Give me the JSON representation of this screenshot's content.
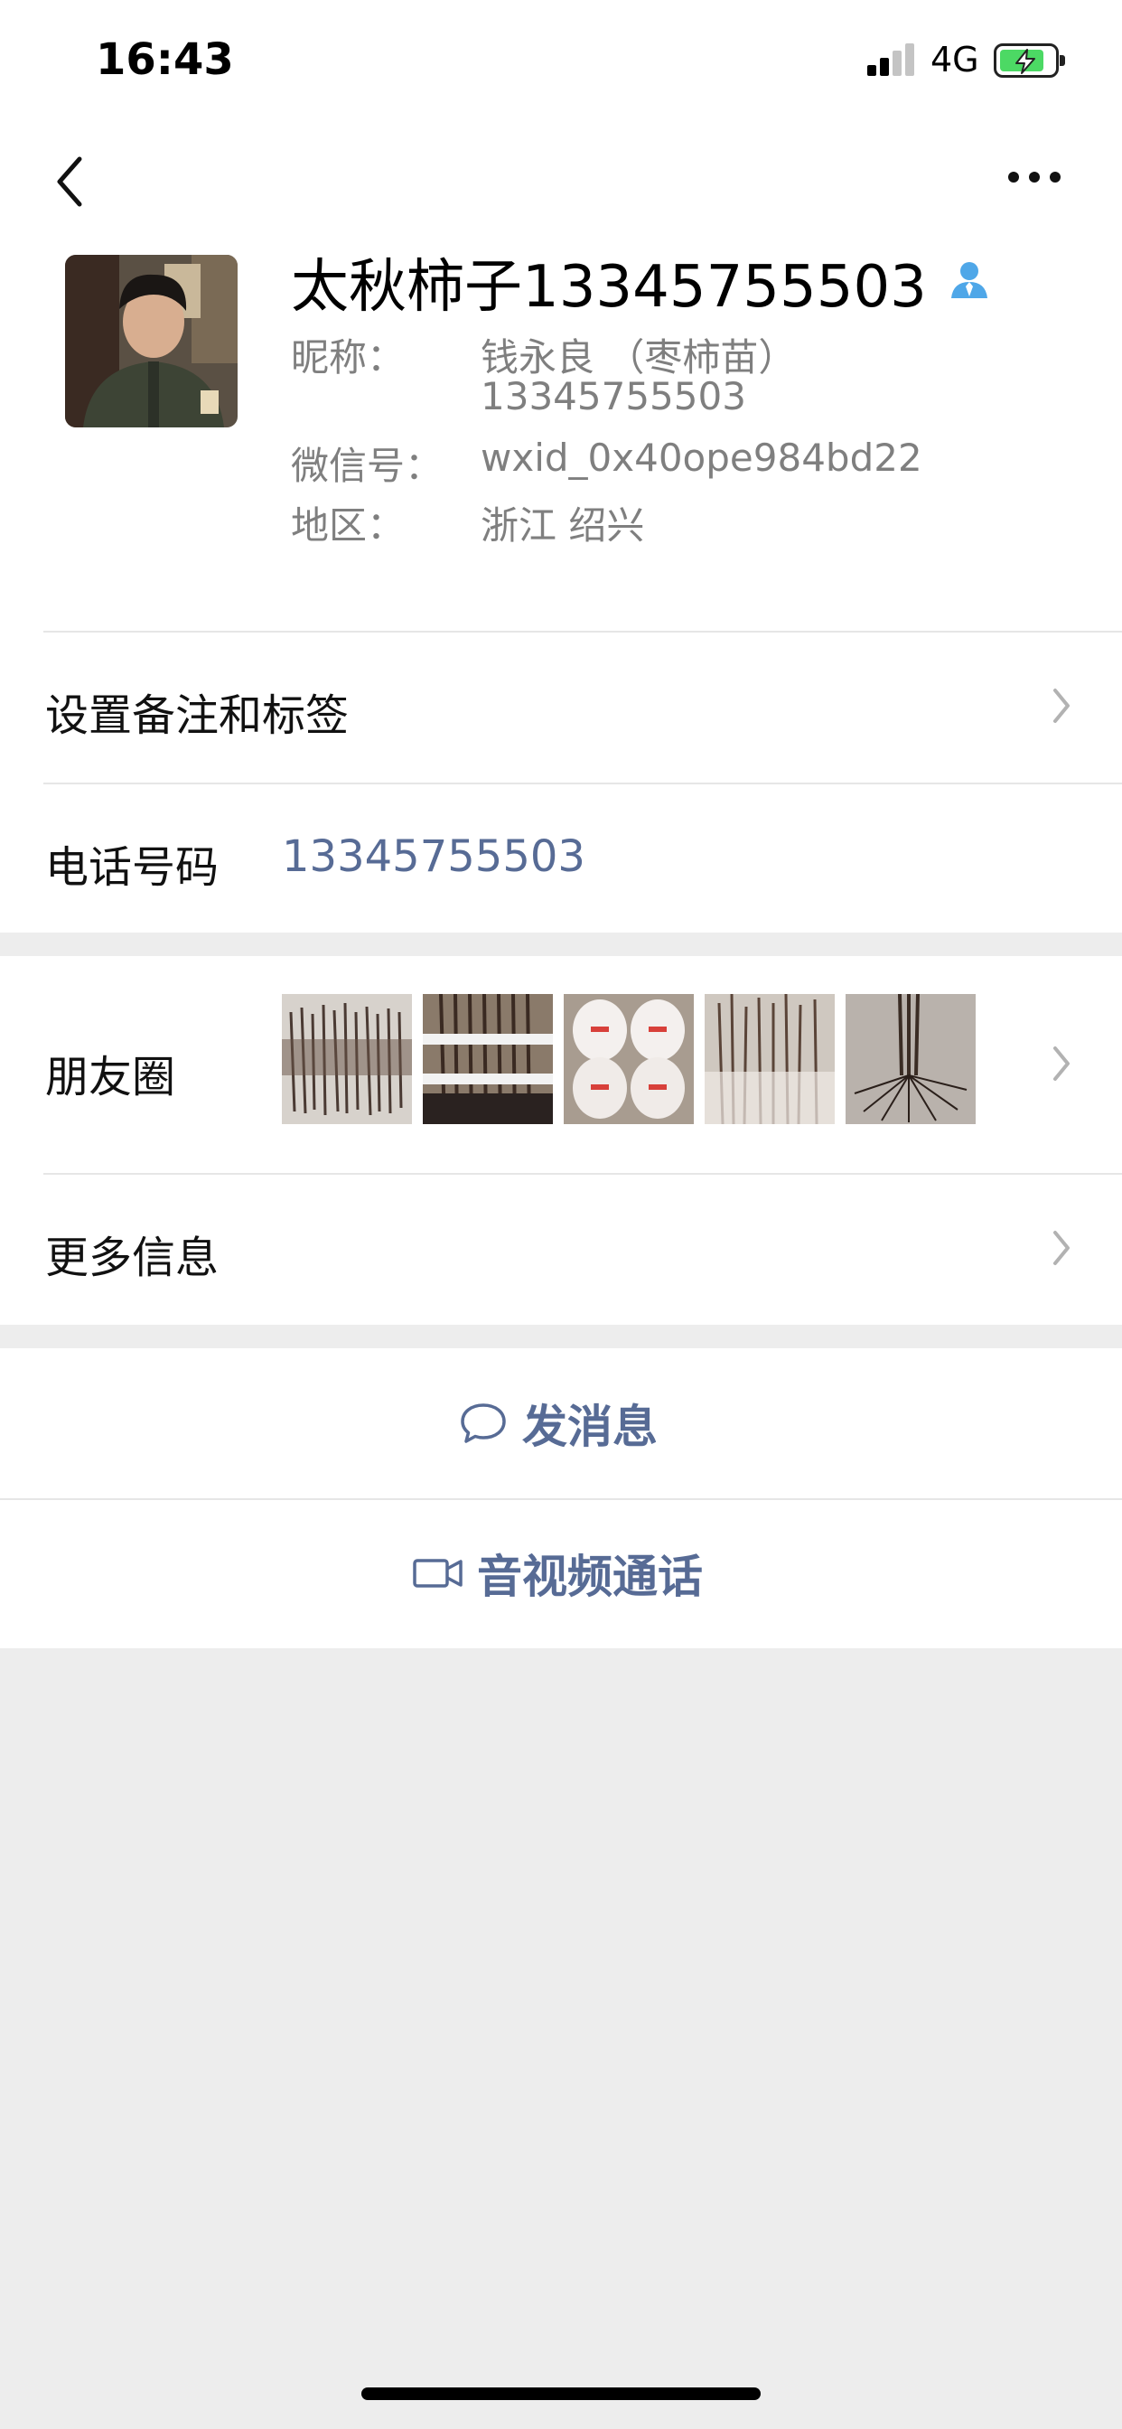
{
  "status_bar": {
    "time": "16:43",
    "network": "4G",
    "signal_level": 0.5,
    "battery_level": 0.85,
    "battery_charging": true
  },
  "nav": {
    "back_icon": "chevron-left-icon",
    "more_icon": "more-dots-icon"
  },
  "profile": {
    "display_name": "太秋柿子13345755503",
    "verify_icon": "contact-verified-icon",
    "nickname_label": "昵称：",
    "nickname_line1": "钱永良 （枣柿苗）",
    "nickname_line2": "13345755503",
    "wechat_id_label": "微信号：",
    "wechat_id": "wxid_0x40ope984bd22",
    "region_label": "地区：",
    "region": "浙江 绍兴"
  },
  "rows": {
    "remark_label": "设置备注和标签",
    "phone_label": "电话号码",
    "phone_value": "13345755503",
    "moments_label": "朋友圈",
    "more_info_label": "更多信息"
  },
  "actions": {
    "message_label": "发消息",
    "message_icon": "chat-bubble-icon",
    "call_label": "音视频通话",
    "call_icon": "video-camera-icon"
  },
  "colors": {
    "link_blue": "#576b95",
    "background_gray": "#ededed",
    "verify_blue": "#4fa7e8"
  }
}
